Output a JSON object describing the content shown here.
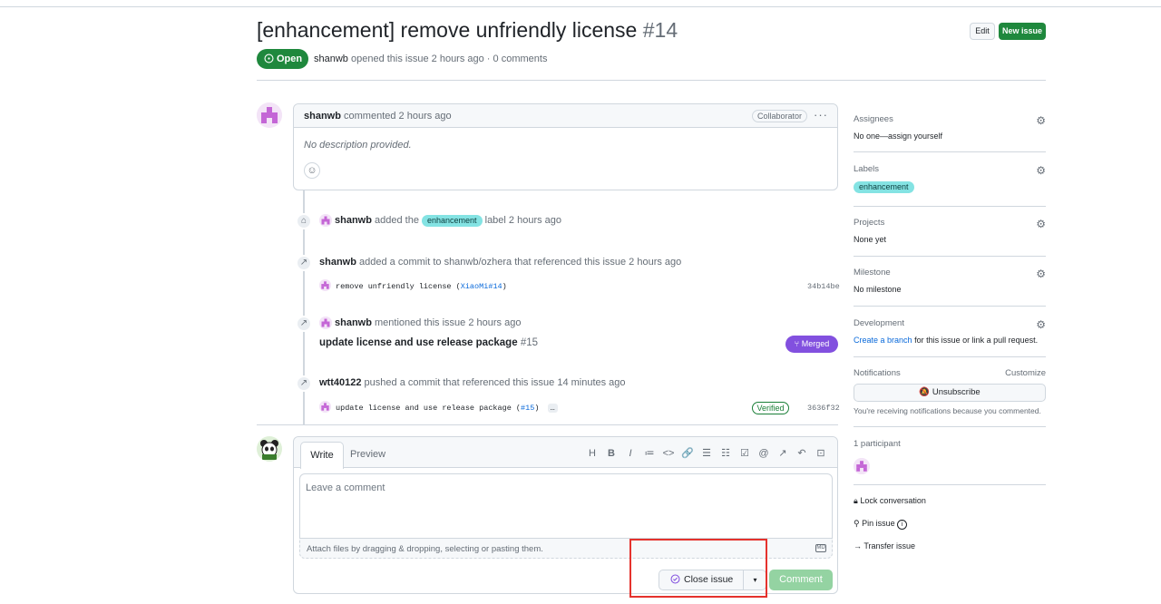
{
  "issue": {
    "title": "[enhancement] remove unfriendly license",
    "number": "#14",
    "state": "Open",
    "author": "shanwb",
    "opened_text": "opened this issue 2 hours ago · 0 comments"
  },
  "header": {
    "edit_label": "Edit",
    "new_issue_label": "New issue"
  },
  "first_comment": {
    "author": "shanwb",
    "meta": "commented 2 hours ago",
    "badge": "Collaborator",
    "menu": "···",
    "body": "No description provided.",
    "reaction_icon": "smiley-icon"
  },
  "timeline": {
    "label_event": {
      "actor": "shanwb",
      "pre": "added the",
      "label": "enhancement",
      "post": "label 2 hours ago"
    },
    "commit_ref": {
      "actor": "shanwb",
      "text": "added a commit to shanwb/ozhera that referenced this issue 2 hours ago",
      "commit_msg": "remove unfriendly license (",
      "commit_link": "XiaoMi#14",
      "commit_close": ")",
      "sha": "34b14be"
    },
    "mention": {
      "actor": "shanwb",
      "text": "mentioned this issue 2 hours ago",
      "pr_title": "update license and use release package",
      "pr_number": "#15",
      "pr_state": "Merged"
    },
    "push": {
      "actor": "wtt40122",
      "text": "pushed a commit that referenced this issue 14 minutes ago",
      "commit_msg": "update license and use release package (",
      "commit_link": "#15",
      "commit_close": ")",
      "more": "…",
      "verified": "Verified",
      "sha": "3636f32"
    }
  },
  "composer": {
    "tab_write": "Write",
    "tab_preview": "Preview",
    "toolbar": [
      "H",
      "B",
      "I",
      "≔",
      "<>",
      "🔗",
      "☰",
      "☷",
      "☑",
      "@",
      "↗",
      "↶",
      "⊡"
    ],
    "placeholder": "Leave a comment",
    "attach_text": "Attach files by dragging & dropping, selecting or pasting them.",
    "markdown_badge": "MD",
    "close_label": "Close issue",
    "comment_label": "Comment"
  },
  "sidebar": {
    "assignees": {
      "title": "Assignees",
      "value": "No one—assign yourself"
    },
    "labels": {
      "title": "Labels",
      "value": "enhancement"
    },
    "projects": {
      "title": "Projects",
      "value": "None yet"
    },
    "milestone": {
      "title": "Milestone",
      "value": "No milestone"
    },
    "development": {
      "title": "Development",
      "link": "Create a branch",
      "rest": "for this issue or link a pull request."
    },
    "notifications": {
      "title": "Notifications",
      "customize": "Customize",
      "button": "Unsubscribe",
      "note": "You're receiving notifications because you commented."
    },
    "participants": {
      "title": "1 participant"
    },
    "actions": {
      "lock": "Lock conversation",
      "pin": "Pin issue",
      "transfer": "Transfer issue"
    }
  },
  "colors": {
    "open_green": "#1f883d",
    "merged_purple": "#8250df",
    "label_teal": "#84e3e3",
    "highlight_red": "#e5322d"
  }
}
